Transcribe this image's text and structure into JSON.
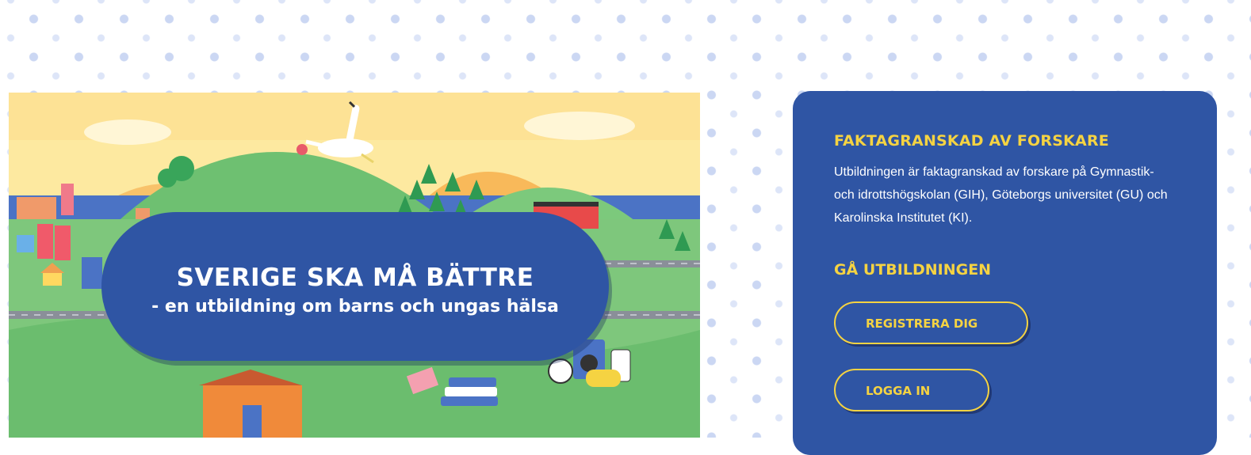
{
  "hero": {
    "title": "SVERIGE SKA MÅ BÄTTRE",
    "subtitle": "- en utbildning om barns och ungas hälsa"
  },
  "info_card": {
    "heading": "FAKTAGRANSKAD AV FORSKARE",
    "body": "Utbildningen är faktagranskad av forskare på Gymnastik- och idrottshögskolan (GIH), Göteborgs universitet (GU) och Karolinska Institutet (KI).",
    "cta_heading": "GÅ UTBILDNINGEN",
    "register_label": "REGISTRERA DIG",
    "login_label": "LOGGA IN"
  },
  "colors": {
    "primary_blue": "#2f55a4",
    "accent_yellow": "#f5d342",
    "dot_blue": "#b9c9ef"
  }
}
